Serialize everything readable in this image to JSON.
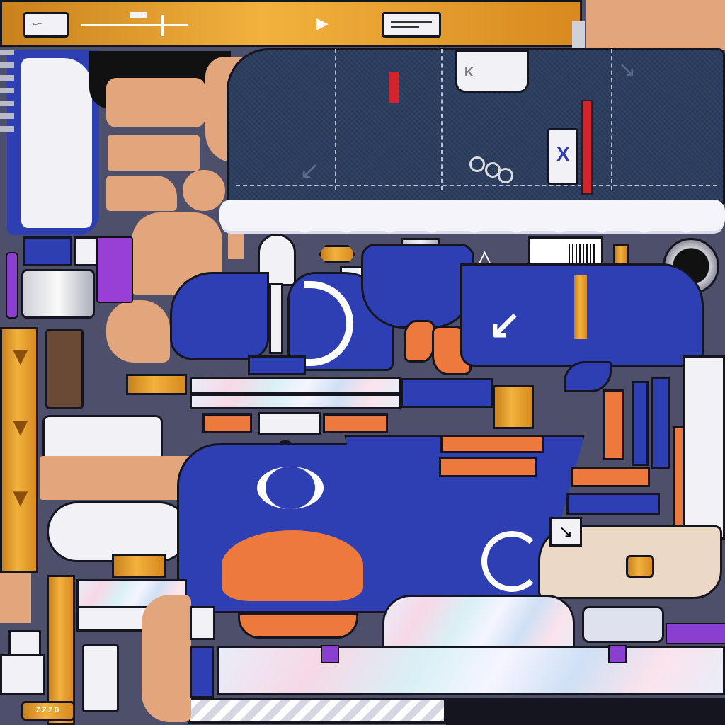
{
  "canvas": {
    "background": "#4e4f6b",
    "palette": {
      "denim": "#2b3d60",
      "jersey_blue": "#2e3fb4",
      "orange": "#ed7a3c",
      "gold": "#f2b23d",
      "skin": "#e3a57c",
      "white": "#f2f2f6",
      "purple": "#8a3fd0",
      "outline": "#151520"
    }
  },
  "top_bar": {
    "play_icon": "play-icon",
    "back_icon": "back-arrow-icon"
  },
  "icons": {
    "x_logo": "x-logo-icon",
    "arrow": "arrow-down-left-icon",
    "triangle": "triangle-logo-icon",
    "ring": "ring-icon"
  },
  "bottom_badge": {
    "text": "ZZZO"
  },
  "decals": {
    "shoulder_logo": "K",
    "tag_logo": "X"
  }
}
